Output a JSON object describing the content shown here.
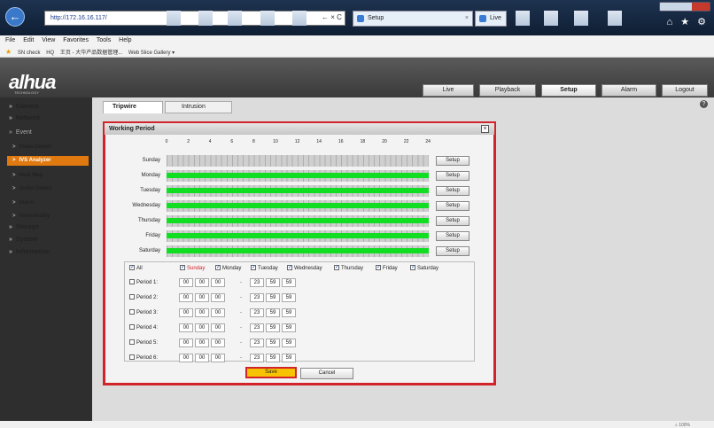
{
  "browser": {
    "address": "http://172.16.16.117/",
    "address_tools": "← × C",
    "tab_setup": "Setup",
    "tab_setup_close": "×",
    "tab_live": "Live",
    "back_glyph": "←",
    "toolbar_icons": "⌂ ★ ⚙",
    "menu": [
      "File",
      "Edit",
      "View",
      "Favorites",
      "Tools",
      "Help"
    ],
    "favorites": [
      "SN check",
      "HQ",
      "王页 - 大华产品数据管理...",
      "Web Slice Gallery ▾"
    ],
    "favorites_star": "★",
    "zoom": "⌕ 100%"
  },
  "app": {
    "logo": "alhua",
    "logo_sub": "TECHNOLOGY",
    "nav": [
      "Live",
      "Playback",
      "Setup",
      "Alarm",
      "Logout"
    ],
    "settings_glyph": "?"
  },
  "sidebar": {
    "items": [
      {
        "label": "Camera",
        "marker": "»"
      },
      {
        "label": "Network",
        "marker": "»"
      },
      {
        "label": "Event",
        "marker": "»"
      },
      {
        "label": "Video Detect",
        "marker": ">"
      },
      {
        "label": "IVS Analyzer",
        "marker": ">"
      },
      {
        "label": "Heat Map",
        "marker": ">"
      },
      {
        "label": "Audio Detect",
        "marker": ">"
      },
      {
        "label": "Alarm",
        "marker": ">"
      },
      {
        "label": "Abnormality",
        "marker": ">"
      },
      {
        "label": "Storage",
        "marker": "»"
      },
      {
        "label": "System",
        "marker": "»"
      },
      {
        "label": "Information",
        "marker": "»"
      }
    ]
  },
  "subtabs": [
    "Tripwire",
    "Intrusion"
  ],
  "dialog": {
    "title": "Working Period",
    "close_label": "×",
    "hours": [
      "0",
      "2",
      "4",
      "6",
      "8",
      "10",
      "12",
      "14",
      "16",
      "18",
      "20",
      "22",
      "24"
    ],
    "days": [
      "Sunday",
      "Monday",
      "Tuesday",
      "Wednesday",
      "Thursday",
      "Friday",
      "Saturday"
    ],
    "day_schedule_fraction": [
      0,
      1,
      1,
      1,
      1,
      1,
      1
    ],
    "setup_label": "Setup",
    "check_mark": "✓",
    "all_label": "All",
    "periods": [
      {
        "label": "Period 1:",
        "start": [
          "00",
          "00",
          "00"
        ],
        "end": [
          "23",
          "59",
          "59"
        ]
      },
      {
        "label": "Period 2:",
        "start": [
          "00",
          "00",
          "00"
        ],
        "end": [
          "23",
          "59",
          "59"
        ]
      },
      {
        "label": "Period 3:",
        "start": [
          "00",
          "00",
          "00"
        ],
        "end": [
          "23",
          "59",
          "59"
        ]
      },
      {
        "label": "Period 4:",
        "start": [
          "00",
          "00",
          "00"
        ],
        "end": [
          "23",
          "59",
          "59"
        ]
      },
      {
        "label": "Period 5:",
        "start": [
          "00",
          "00",
          "00"
        ],
        "end": [
          "23",
          "59",
          "59"
        ]
      },
      {
        "label": "Period 6:",
        "start": [
          "00",
          "00",
          "00"
        ],
        "end": [
          "23",
          "59",
          "59"
        ]
      }
    ],
    "dash": "-",
    "save_label": "Save",
    "cancel_label": "Cancel"
  },
  "colors": {
    "schedule_green": "#11dd22",
    "highlight_red": "#d2232a",
    "save_yellow": "#f7c200",
    "active_orange": "#e07a10"
  }
}
